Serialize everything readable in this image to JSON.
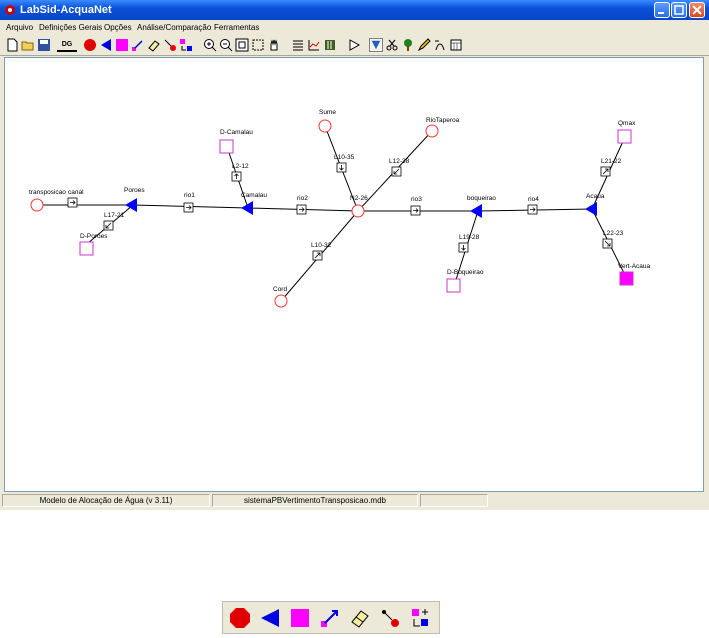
{
  "window": {
    "title": "LabSid-AcquaNet"
  },
  "menu": [
    {
      "label": "Arquivo"
    },
    {
      "label": "Definições Gerais"
    },
    {
      "label": "Opções"
    },
    {
      "label": "Análise/Comparação"
    },
    {
      "label": "Ferramentas"
    }
  ],
  "toolbar": {
    "dg_label": "DG",
    "tools": [
      "new-file-icon",
      "open-folder-icon",
      "save-icon",
      "dg-button",
      "demand-node-icon",
      "reservoir-icon",
      "sink-node-icon",
      "link-icon",
      "eraser-icon",
      "reduce-link-icon",
      "move-node-icon",
      "zoom-in-icon",
      "zoom-out-icon",
      "zoom-fit-icon",
      "zoom-window-icon",
      "pan-hand-icon",
      "list-icon",
      "chart-icon",
      "book-icon",
      "run-icon",
      "filter-icon",
      "scissors-icon",
      "tree-icon",
      "pencil-icon",
      "data-icon",
      "calendar-icon"
    ]
  },
  "colors": {
    "demand": "#ff3333",
    "sink": "#cc33cc",
    "sink_fill": "#ff00ff",
    "reservoir": "#0000ff"
  },
  "network": {
    "nodes": {
      "transposicao": "transposicao",
      "poroes": "Poroes",
      "camalau": "Camalau",
      "n26": "N2-26",
      "boqueirao": "boqueirao",
      "acaua": "Acaua",
      "sume": "Sume",
      "riotaperoa": "RioTaperoa",
      "cord": "Cord",
      "dcamalau": "D-Camalau",
      "dporoes": "D-Poroes",
      "dboqueirao": "D-Boqueirao",
      "qmax": "Qmax",
      "vertacaua": "Vert-Acaua"
    },
    "links": {
      "canal": "canal",
      "rio1": "rio1",
      "rio2": "rio2",
      "rio3": "rio3",
      "rio4": "rio4",
      "l1721": "L17-21",
      "l212": "L2-12",
      "l1035": "L10-35",
      "l1238": "L12-38",
      "l1032": "L10-32",
      "l1928": "L19-28",
      "l2122": "L21-22",
      "l2223": "L22-23"
    }
  },
  "status": {
    "model": "Modelo de Alocação de Água (v 3.11)",
    "file": "sistemaPBVertimentoTransposicao.mdb"
  },
  "bottom_tools": [
    "demand-node-icon",
    "reservoir-icon",
    "sink-node-icon",
    "link-icon",
    "eraser-icon",
    "reduce-link-icon",
    "move-node-icon"
  ]
}
